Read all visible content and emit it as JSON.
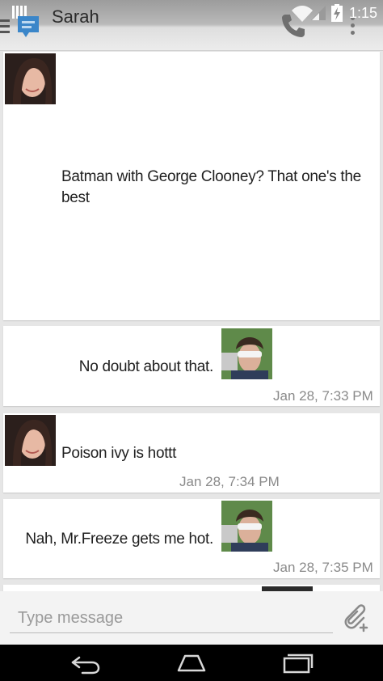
{
  "status_bar": {
    "time": "1:15",
    "icons": [
      "notification-icon",
      "wifi-icon",
      "signal-icon",
      "battery-charging-icon"
    ]
  },
  "action_bar": {
    "title": "Sarah",
    "icons": [
      "menu-icon",
      "messaging-app-icon",
      "phone-icon",
      "overflow-menu-icon"
    ]
  },
  "messages": [
    {
      "sender": "contact",
      "text": "Batman with George Clooney? That one's the best",
      "timestamp": ""
    },
    {
      "sender": "me",
      "text": "No doubt about that.",
      "timestamp": "Jan 28, 7:33 PM"
    },
    {
      "sender": "contact",
      "text": "Poison ivy is hottt",
      "timestamp": "Jan 28, 7:34 PM"
    },
    {
      "sender": "me",
      "text": "Nah, Mr.Freeze gets me hot.",
      "timestamp": "Jan 28, 7:35 PM"
    }
  ],
  "compose": {
    "placeholder": "Type message",
    "value": "",
    "attach_icon": "attach-icon"
  },
  "nav_bar": {
    "icons": [
      "back-icon",
      "home-icon",
      "recents-icon"
    ]
  },
  "colors": {
    "background": "#e6e6e6",
    "card": "#ffffff",
    "timestamp": "#8a8a8a",
    "accent": "#3b86c9"
  }
}
